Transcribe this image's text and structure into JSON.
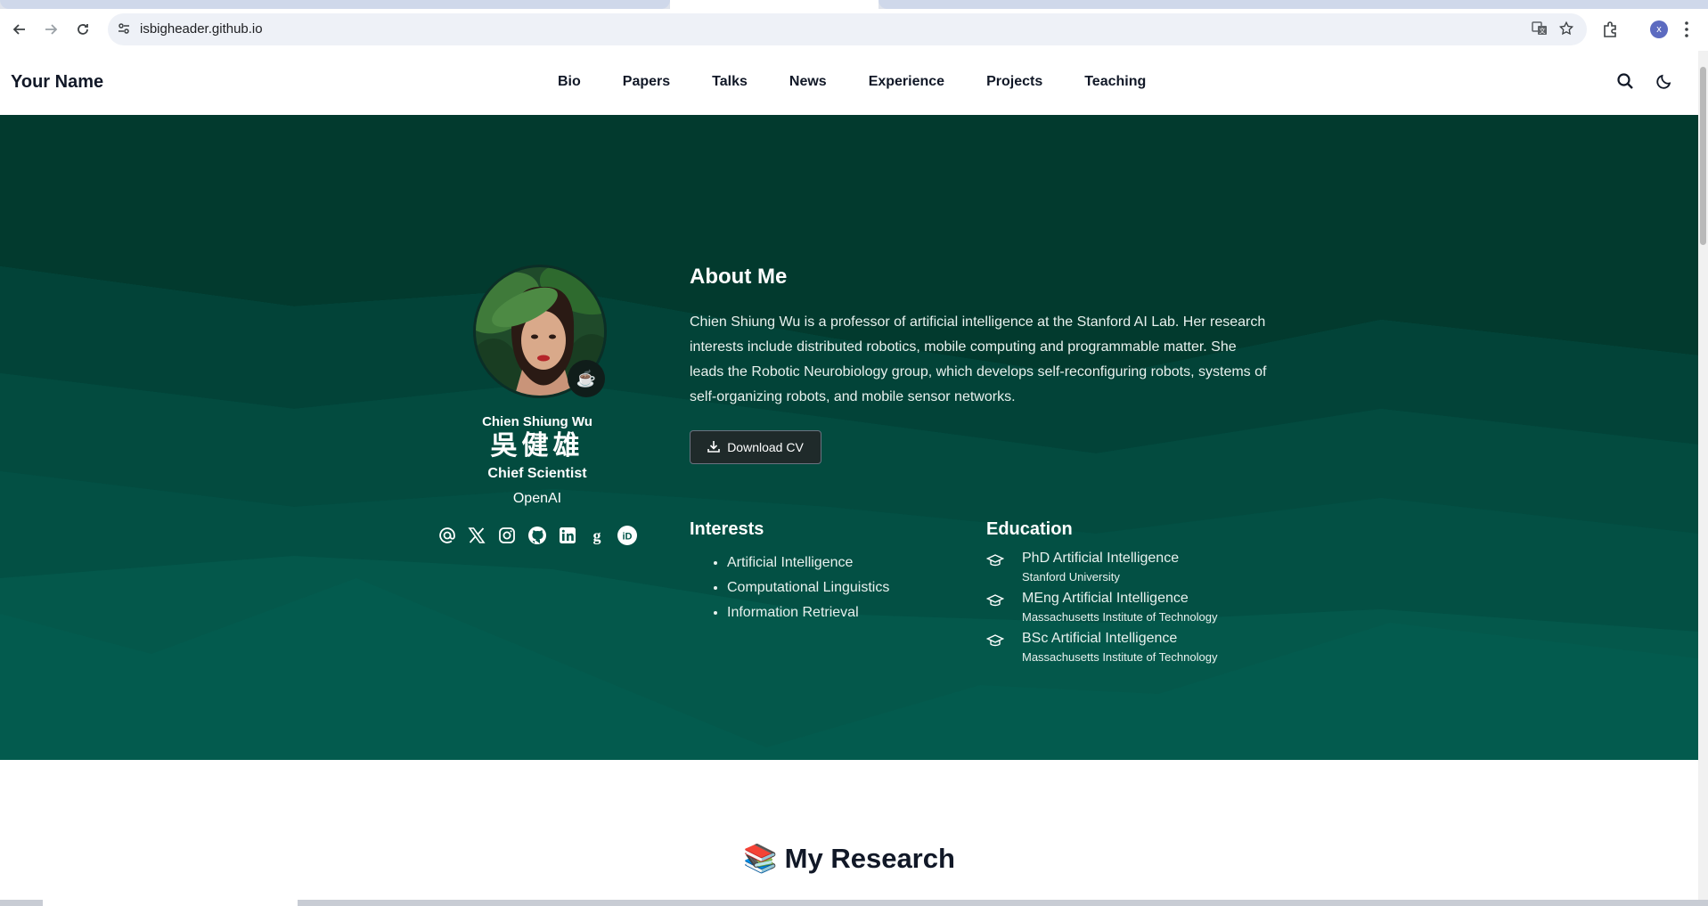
{
  "browser": {
    "url": "isbigheader.github.io",
    "profile_initial": "x",
    "icons": [
      "back-icon",
      "forward-icon",
      "reload-icon",
      "site-settings-icon",
      "translate-icon",
      "bookmark-star-icon",
      "extensions-icon",
      "menu-kebab-icon"
    ]
  },
  "site": {
    "brand": "Your Name",
    "menu": [
      "Bio",
      "Papers",
      "Talks",
      "News",
      "Experience",
      "Projects",
      "Teaching"
    ],
    "icons": [
      "search-icon",
      "dark-mode-moon-icon"
    ]
  },
  "profile": {
    "name": "Chien Shiung Wu",
    "name_cjk": "吳健雄",
    "role": "Chief Scientist",
    "organization": "OpenAI",
    "status_emoji": "☕",
    "socials": [
      "email-at-icon",
      "x-twitter-icon",
      "instagram-icon",
      "github-icon",
      "linkedin-icon",
      "google-scholar-icon",
      "orcid-icon"
    ]
  },
  "about": {
    "heading": "About Me",
    "bio": "Chien Shiung Wu is a professor of artificial intelligence at the Stanford AI Lab. Her research interests include distributed robotics, mobile computing and programmable matter. She leads the Robotic Neurobiology group, which develops self-reconfiguring robots, systems of self-organizing robots, and mobile sensor networks.",
    "cv_label": "Download CV"
  },
  "interests": {
    "heading": "Interests",
    "items": [
      "Artificial Intelligence",
      "Computational Linguistics",
      "Information Retrieval"
    ]
  },
  "education": {
    "heading": "Education",
    "items": [
      {
        "degree": "PhD Artificial Intelligence",
        "institution": "Stanford University"
      },
      {
        "degree": "MEng Artificial Intelligence",
        "institution": "Massachusetts Institute of Technology"
      },
      {
        "degree": "BSc Artificial Intelligence",
        "institution": "Massachusetts Institute of Technology"
      }
    ]
  },
  "research": {
    "emoji": "📚",
    "heading": "My Research"
  },
  "colors": {
    "hero_base": "#04564a",
    "hero_dark": "#023a2e",
    "hero_mid": "#035044",
    "text_dark": "#111827"
  }
}
